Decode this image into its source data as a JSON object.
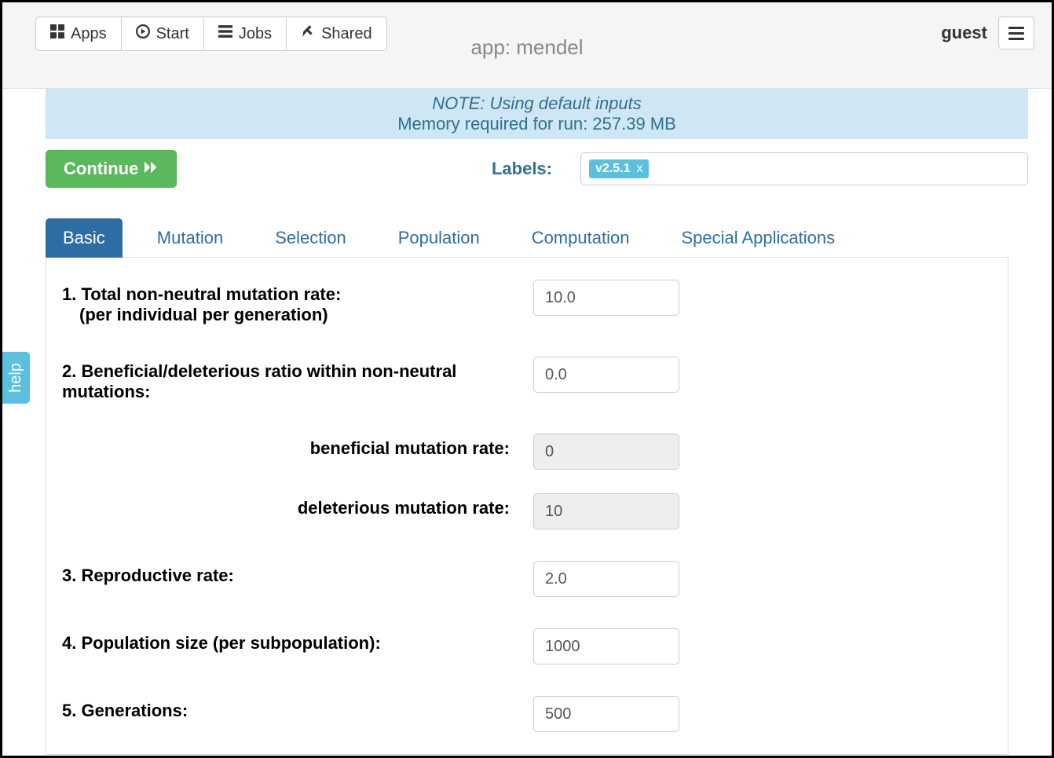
{
  "topbar": {
    "apps": "Apps",
    "start": "Start",
    "jobs": "Jobs",
    "shared": "Shared",
    "app_title": "app: mendel",
    "user": "guest"
  },
  "banner": {
    "note": "NOTE: Using default inputs",
    "memory": "Memory required for run: 257.39 MB"
  },
  "controls": {
    "continue": "Continue",
    "labels_label": "Labels:",
    "tags": [
      "v2.5.1"
    ]
  },
  "tabs": {
    "items": [
      "Basic",
      "Mutation",
      "Selection",
      "Population",
      "Computation",
      "Special Applications"
    ],
    "active": 0
  },
  "form": {
    "r1_label": "1. Total non-neutral mutation rate:",
    "r1_sub": "(per individual per generation)",
    "r1_value": "10.0",
    "r2_label": "2. Beneficial/deleterious ratio within non-neutral mutations:",
    "r2_value": "0.0",
    "r2a_label": "beneficial mutation rate:",
    "r2a_value": "0",
    "r2b_label": "deleterious mutation rate:",
    "r2b_value": "10",
    "r3_label": "3. Reproductive rate:",
    "r3_value": "2.0",
    "r4_label": "4. Population size (per subpopulation):",
    "r4_value": "1000",
    "r5_label": "5. Generations:",
    "r5_value": "500"
  },
  "help_tab": "help"
}
